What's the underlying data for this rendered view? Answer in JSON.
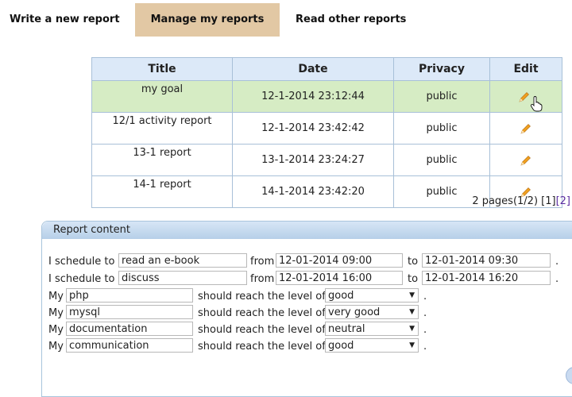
{
  "tabs": {
    "write": "Write a new report",
    "manage": "Manage my reports",
    "read": "Read other reports"
  },
  "table": {
    "headers": [
      "Title",
      "Date",
      "Privacy",
      "Edit"
    ],
    "rows": [
      {
        "title": "my goal",
        "date": "12-1-2014 23:12:44",
        "privacy": "public"
      },
      {
        "title": "12/1 activity report",
        "date": "12-1-2014 23:42:42",
        "privacy": "public"
      },
      {
        "title": "13-1 report",
        "date": "13-1-2014 23:24:27",
        "privacy": "public"
      },
      {
        "title": "14-1 report",
        "date": "14-1-2014 23:42:20",
        "privacy": "public"
      }
    ],
    "edit_icon": "pencil-icon"
  },
  "pager": {
    "text": "2 pages(1/2) ",
    "page1": "[1]",
    "page2": "[2]"
  },
  "panel": {
    "title": "Report content",
    "schedule_prefix": "I schedule to",
    "from_label": "from",
    "to_label": "to",
    "period": ".",
    "schedules": [
      {
        "activity": "read an e-book",
        "from": "12-01-2014 09:00",
        "to": "12-01-2014 09:30"
      },
      {
        "activity": "discuss",
        "from": "12-01-2014 16:00",
        "to": "12-01-2014 16:20"
      }
    ],
    "my_label": "My",
    "reach_label": "should reach the level of",
    "skills": [
      {
        "skill": "php",
        "level": "good"
      },
      {
        "skill": "mysql",
        "level": "very good"
      },
      {
        "skill": "documentation",
        "level": "neutral"
      },
      {
        "skill": "communication",
        "level": "good"
      }
    ]
  },
  "colors": {
    "active_tab": "#e2c8a4",
    "header_bg": "#dce9f8",
    "highlight_row": "#d6ecc4",
    "pencil": "#f0a020"
  }
}
